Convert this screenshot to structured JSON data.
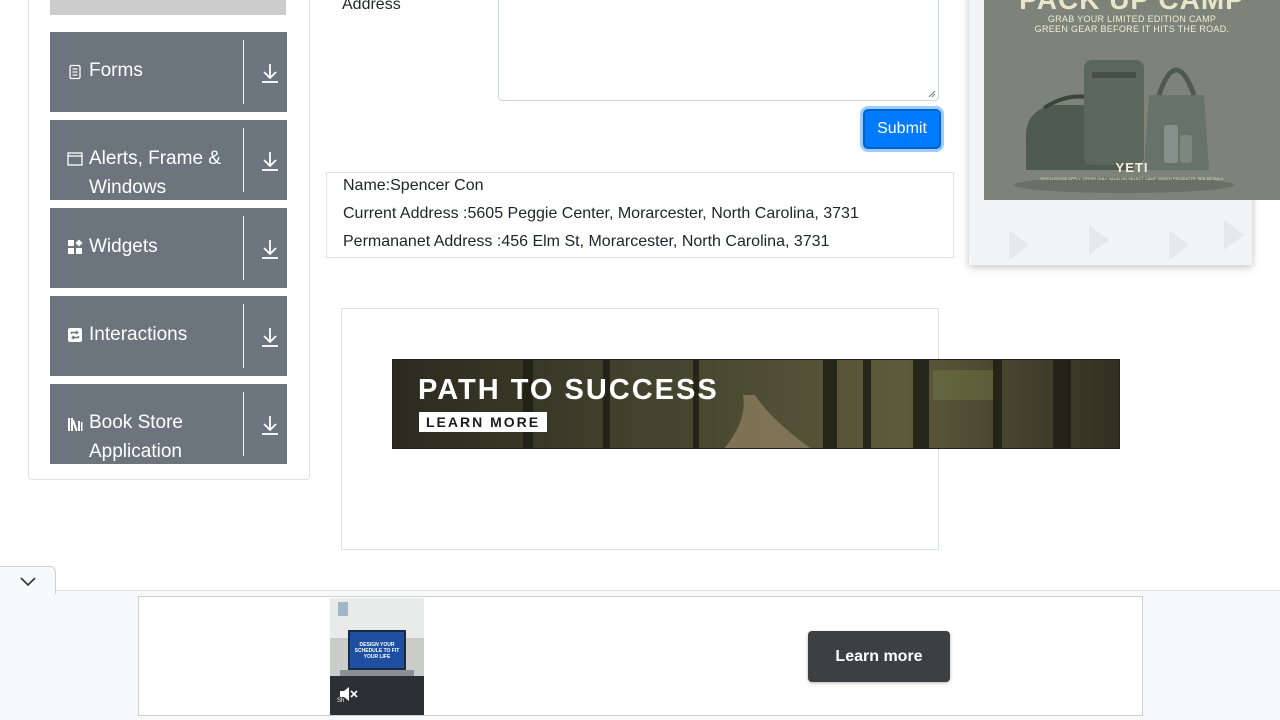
{
  "sidebar": {
    "groups": [
      {
        "label": "Forms",
        "icon": "form-icon"
      },
      {
        "label": "Alerts, Frame & Windows",
        "icon": "window-icon"
      },
      {
        "label": "Widgets",
        "icon": "widgets-icon"
      },
      {
        "label": "Interactions",
        "icon": "interactions-icon"
      },
      {
        "label": "Book Store Application",
        "icon": "book-icon"
      }
    ]
  },
  "form": {
    "address_label": "Address",
    "submit_label": "Submit"
  },
  "output": {
    "name": "Name:Spencer Con",
    "current_address": "Current Address :5605 Peggie Center, Morarcester, North Carolina, 3731",
    "permanent_address": "Permananet Address :456 Elm St, Morarcester, North Carolina, 3731"
  },
  "ads": {
    "right": {
      "headline": "PACK UP CAMP",
      "sub1": "GRAB YOUR LIMITED EDITION CAMP",
      "sub2": "GREEN GEAR BEFORE IT HITS THE ROAD.",
      "brand": "YETI",
      "fine_print": "*EXCLUSIONS APPLY. OFFER ONLY VALID ON SELECT CAMP GREEN PRODUCTS. SEE DETAILS."
    },
    "banner": {
      "title": "PATH TO SUCCESS",
      "cta": "LEARN MORE"
    },
    "sticky": {
      "screen_text": "DESIGN YOUR SCHEDULE TO FIT YOUR LIFE",
      "thumb_caption": "Sh",
      "cta": "Learn more"
    }
  },
  "colors": {
    "sidebar_group": "#6c757d",
    "submit": "#007bff",
    "learn_more": "#3c4043"
  }
}
